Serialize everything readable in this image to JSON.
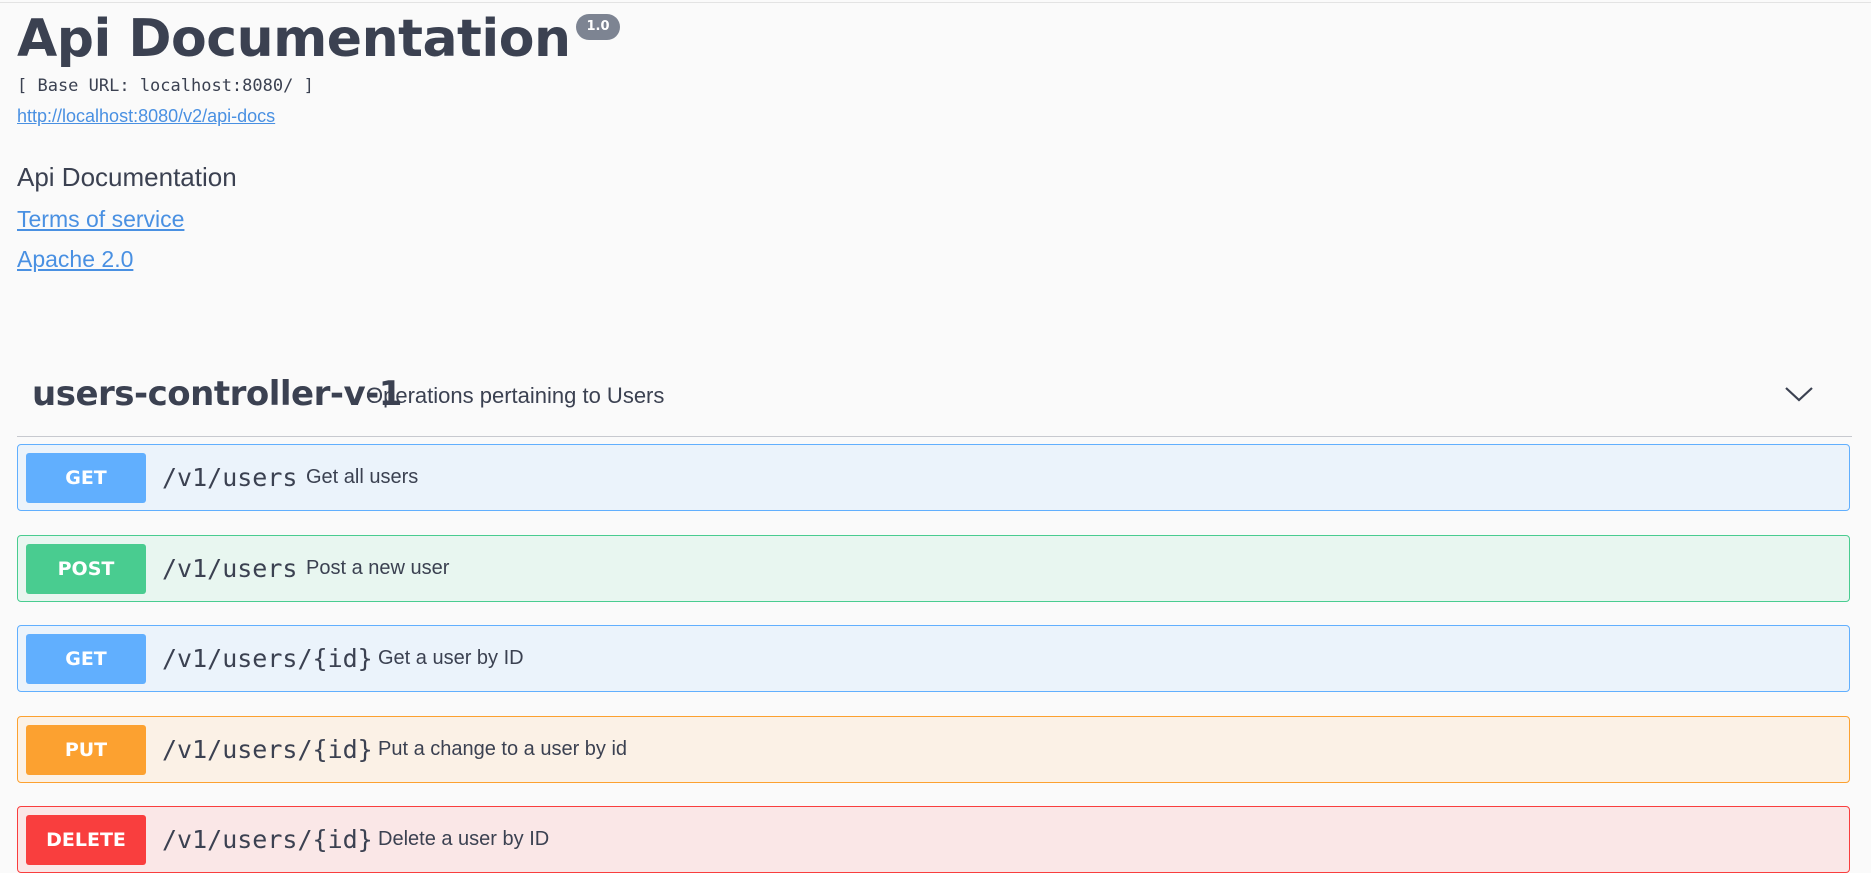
{
  "info": {
    "title": "Api Documentation",
    "version": "1.0",
    "base_url": "[ Base URL: localhost:8080/ ]",
    "spec_url": "http://localhost:8080/v2/api-docs",
    "description": "Api Documentation",
    "terms_label": "Terms of service",
    "license_label": "Apache 2.0"
  },
  "tag": {
    "name": "users-controller-v-1",
    "description": "Operations pertaining to Users",
    "toggle_icon": "chevron-down-icon"
  },
  "operations": [
    {
      "method": "GET",
      "path": "/v1/users",
      "summary": "Get all users",
      "color": "#61affe"
    },
    {
      "method": "POST",
      "path": "/v1/users",
      "summary": "Post a new user",
      "color": "#49cc90"
    },
    {
      "method": "GET",
      "path": "/v1/users/{id}",
      "summary": "Get a user by ID",
      "color": "#61affe"
    },
    {
      "method": "PUT",
      "path": "/v1/users/{id}",
      "summary": "Put a change to a user by id",
      "color": "#fca130"
    },
    {
      "method": "DELETE",
      "path": "/v1/users/{id}",
      "summary": "Delete a user by ID",
      "color": "#f93e3e"
    }
  ],
  "colors": {
    "link": "#4990e2",
    "text": "#3b4151",
    "version_badge": "#7d8492"
  }
}
